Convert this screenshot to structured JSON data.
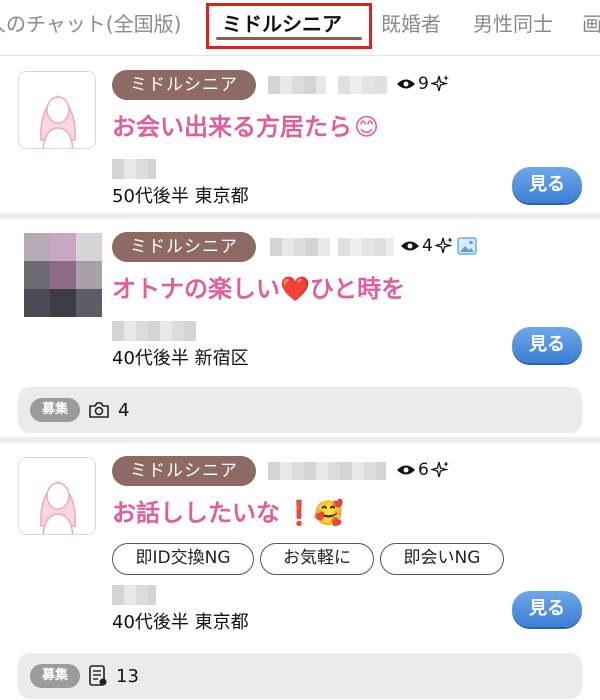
{
  "tabs": [
    {
      "label": "人のチャット(全国版)",
      "active": false
    },
    {
      "label": "ミドルシニア",
      "active": true
    },
    {
      "label": "既婚者",
      "active": false
    },
    {
      "label": "男性同士",
      "active": false
    },
    {
      "label": "画",
      "active": false
    }
  ],
  "posts": [
    {
      "category": "ミドルシニア",
      "views": "9",
      "title": "お会い出来る方居たら",
      "title_emoji": "😊",
      "meta": "50代後半 東京都",
      "see_label": "見る",
      "thumbnail": "default-female-avatar"
    },
    {
      "category": "ミドルシニア",
      "views": "4",
      "title_part1": "オトナの楽しい",
      "title_emoji": "❤️",
      "title_part2": "ひと時を",
      "meta": "40代後半 新宿区",
      "see_label": "見る",
      "thumbnail": "blurred-photo",
      "badge": "募集",
      "photo_count": "4"
    },
    {
      "category": "ミドルシニア",
      "views": "6",
      "title": "お話ししたいな",
      "title_emoji": "❗🥰",
      "tags": [
        "即ID交換NG",
        "お気軽に",
        "即会いNG"
      ],
      "meta": "40代後半 東京都",
      "see_label": "見る",
      "thumbnail": "default-female-avatar",
      "badge": "募集",
      "doc_count": "13"
    }
  ],
  "colors": {
    "category_pill": "#8e6a64",
    "title_pink": "#e05e9e",
    "button_blue": "#4a8bdc",
    "active_tab_border": "#e02020"
  }
}
